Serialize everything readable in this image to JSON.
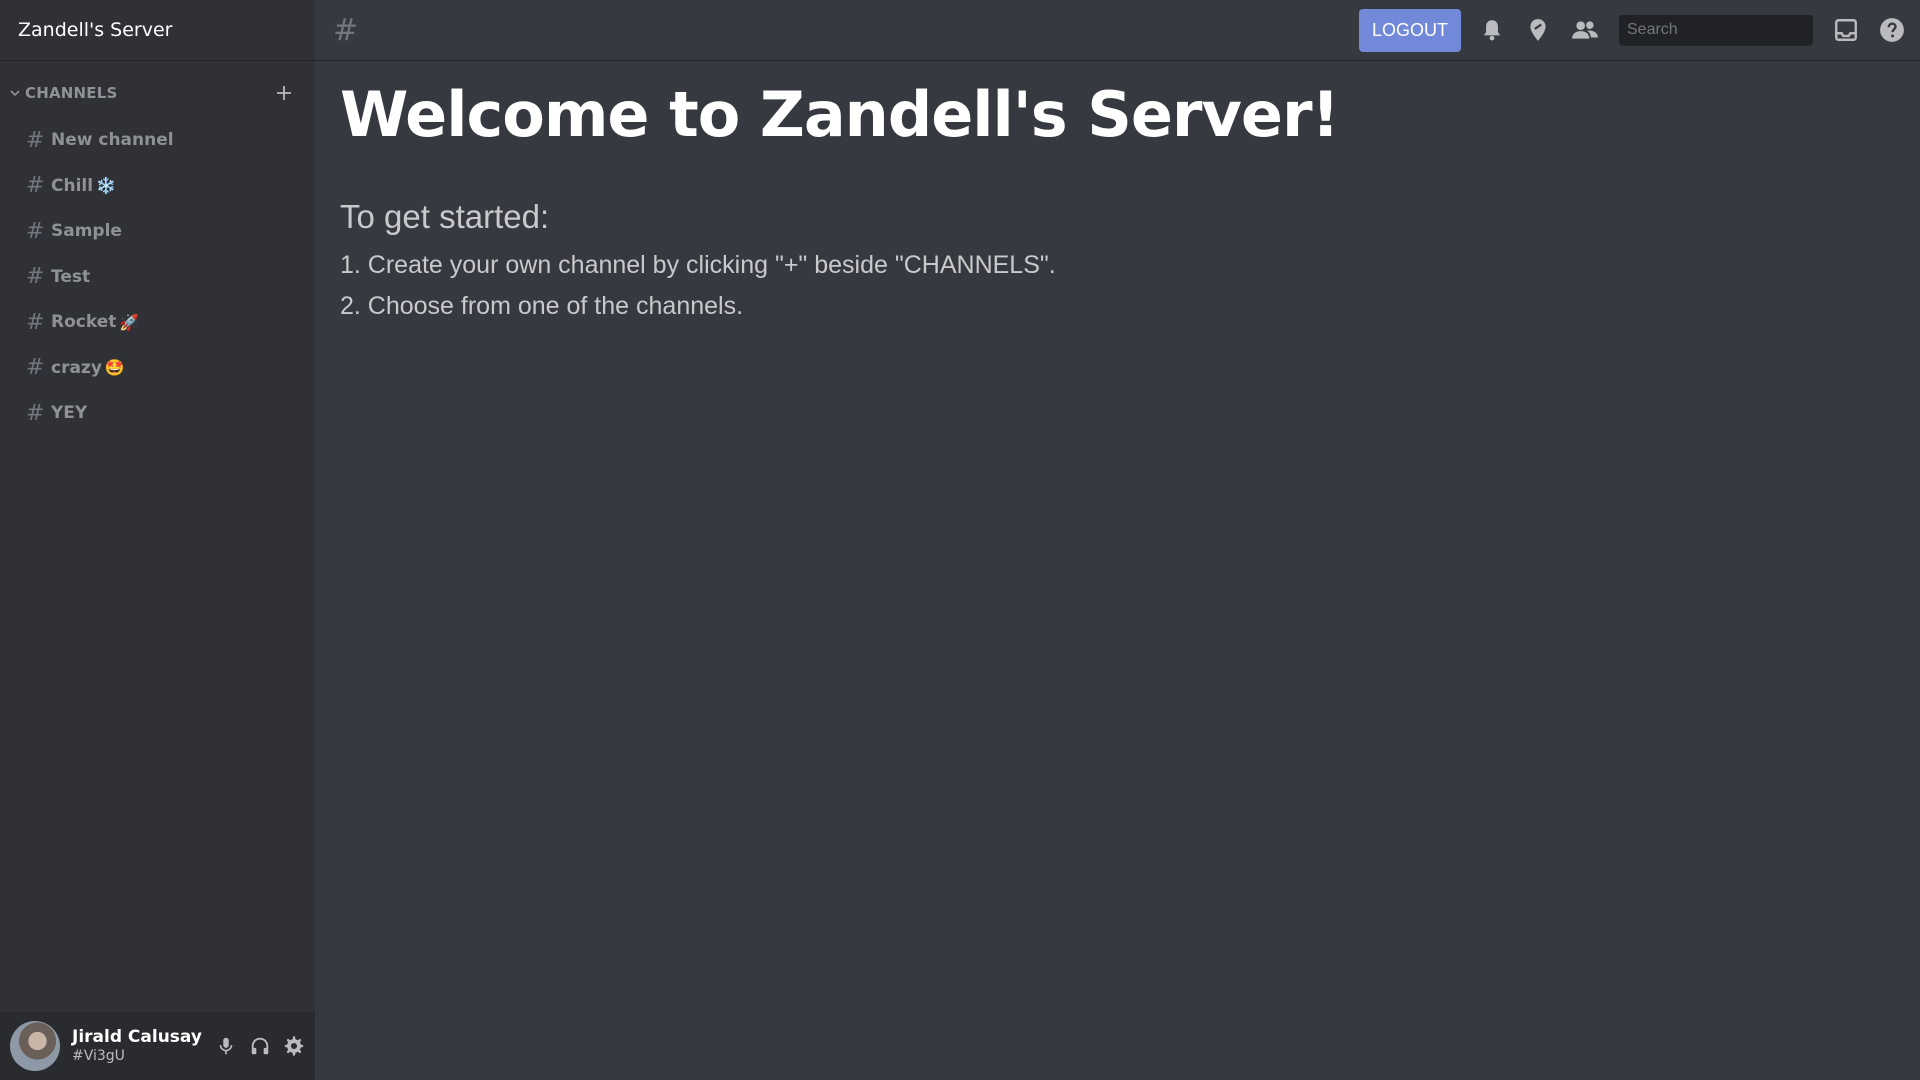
{
  "server": {
    "name": "Zandell's Server"
  },
  "sidebar": {
    "section_label": "CHANNELS",
    "channels": [
      {
        "name": "New channel",
        "emoji": ""
      },
      {
        "name": "Chill",
        "emoji": "❄️"
      },
      {
        "name": "Sample",
        "emoji": ""
      },
      {
        "name": "Test",
        "emoji": ""
      },
      {
        "name": "Rocket",
        "emoji": "🚀"
      },
      {
        "name": "crazy",
        "emoji": "🤩"
      },
      {
        "name": "YEY",
        "emoji": ""
      }
    ],
    "channel_prefix": "#"
  },
  "user": {
    "name": "Jirald Calusay",
    "tag": "#Vi3gU"
  },
  "topbar": {
    "channel_symbol": "#",
    "logout_label": "LOGOUT",
    "search_placeholder": "Search",
    "icons": [
      "bell-icon",
      "pin-icon",
      "members-icon",
      "search-icon",
      "inbox-icon",
      "help-icon"
    ]
  },
  "main": {
    "title": "Welcome to Zandell's Server!",
    "subtitle": "To get started:",
    "steps": [
      "1. Create your own channel by clicking \"+\" beside \"CHANNELS\".",
      "2. Choose from one of the channels."
    ]
  },
  "colors": {
    "accent": "#7289da",
    "background": "#36393f",
    "sidebar": "#2f3136",
    "user_panel": "#292b2f"
  }
}
